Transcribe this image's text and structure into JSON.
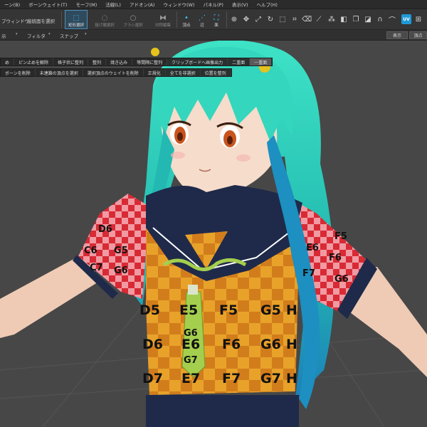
{
  "menubar": {
    "items": [
      "ーン(B)",
      "ボーンウェイト(T)",
      "モーフ(M)",
      "法線(L)",
      "アドオン(A)",
      "ウィンドウ(W)",
      "パネル(P)",
      "表示(V)",
      "ヘルプ(H)"
    ]
  },
  "toolbar": {
    "window_label": "プウィンドウ",
    "select_connected_label": "接続面を選択",
    "rect_select": "矩形選択",
    "lasso_select": "投げ縄選択",
    "brush_select": "ブラシ選択",
    "symmetric_edit": "対称編集",
    "vertex": "頂点",
    "edge": "辺",
    "face": "面",
    "uv_label": "UV"
  },
  "filterbar": {
    "left_label": "示",
    "filter_label": "フィルタ",
    "snap_label": "スナップ",
    "display_button": "表示",
    "vertex_button": "頂点"
  },
  "context_menu": {
    "row1": [
      "め",
      "ピン止めを解除",
      "格子状に整列",
      "整列",
      "焼き込み",
      "等間隔に整列",
      "クリップボードへ画像出力",
      "二重面",
      "一重面"
    ],
    "row1_selected_index": 8,
    "row2": [
      "ボーンを削除",
      "未連鎖の頂点を選択",
      "選択頂点のウェイトを削除",
      "正規化",
      "全てを非選択",
      "位置を整列"
    ]
  },
  "viewport": {
    "texture_labels": {
      "row_d5": [
        "D5",
        "E5",
        "F5",
        "G5",
        "H"
      ],
      "row_d6": [
        "D6",
        "E6",
        "F6",
        "G6",
        "H"
      ],
      "row_d7": [
        "D7",
        "E7",
        "F7",
        "G7",
        "H"
      ],
      "tie": [
        "G6",
        "G7"
      ],
      "sleeve_left": [
        "G5",
        "G6",
        "C6",
        "C7",
        "D6"
      ],
      "sleeve_right": [
        "F5",
        "F6",
        "G6",
        "E6",
        "F7"
      ]
    }
  },
  "colors": {
    "background": "#474747",
    "hair": "#2ed3b8",
    "skin": "#f2d3bf",
    "navy": "#1f2a4a",
    "check_orange": "#e8a22a",
    "check_dark": "#d27d1c",
    "sleeve_red": "#d82a35",
    "sleeve_pink": "#f19aa2",
    "tie_green": "#a4cf4e",
    "accent_blue": "#39c6ff"
  }
}
